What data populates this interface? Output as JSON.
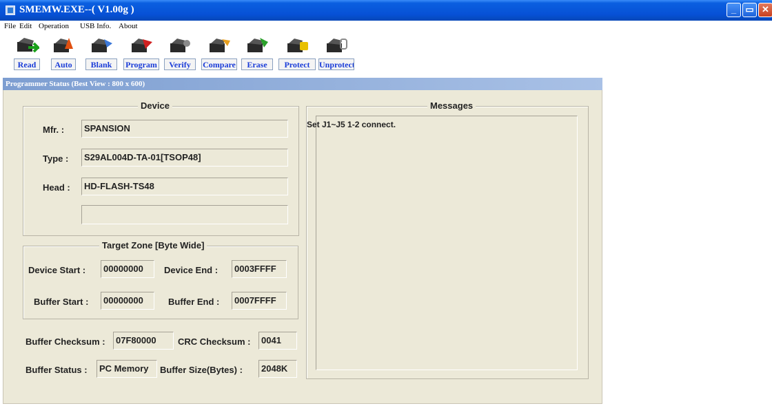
{
  "window": {
    "title": "SMEMW.EXE--( V1.00g )",
    "controls": [
      "minimize-icon",
      "maximize-icon",
      "close-icon"
    ]
  },
  "menu": [
    "File",
    "Edit",
    "Operation",
    "USB Info.",
    "About"
  ],
  "toolbar": [
    {
      "label": "Read",
      "icon": "read-icon"
    },
    {
      "label": "Auto",
      "icon": "auto-icon"
    },
    {
      "label": "Blank",
      "icon": "blank-icon"
    },
    {
      "label": "Program",
      "icon": "program-icon"
    },
    {
      "label": "Verify",
      "icon": "verify-icon"
    },
    {
      "label": "Compare",
      "icon": "compare-icon"
    },
    {
      "label": "Erase",
      "icon": "erase-icon"
    },
    {
      "label": "Protect",
      "icon": "protect-icon"
    },
    {
      "label": "Unprotect",
      "icon": "unprotect-icon"
    }
  ],
  "status_window": {
    "title": "Programmer Status  (Best View : 800 x 600)",
    "device": {
      "legend": "Device",
      "mfr_label": "Mfr. :",
      "mfr_value": "SPANSION",
      "type_label": "Type :",
      "type_value": "S29AL004D-TA-01[TSOP48]",
      "head_label": "Head :",
      "head_value": "HD-FLASH-TS48",
      "extra_value": ""
    },
    "target_zone": {
      "legend": "Target Zone [Byte Wide]",
      "device_start_label": "Device Start :",
      "device_start_value": "00000000",
      "device_end_label": "Device End :",
      "device_end_value": "0003FFFF",
      "buffer_start_label": "Buffer Start :",
      "buffer_start_value": "00000000",
      "buffer_end_label": "Buffer End :",
      "buffer_end_value": "0007FFFF"
    },
    "buffer_checksum_label": "Buffer Checksum :",
    "buffer_checksum_value": "07F80000",
    "crc_checksum_label": "CRC Checksum :",
    "crc_checksum_value": "0041",
    "buffer_status_label": "Buffer Status :",
    "buffer_status_value": "PC Memory",
    "buffer_size_label": "Buffer Size(Bytes) :",
    "buffer_size_value": "2048K",
    "messages": {
      "legend": "Messages",
      "text": "Set J1~J5 1-2 connect."
    }
  },
  "colors": {
    "titlebar": "#0751d6",
    "panel": "#ece9d8",
    "toolbar_label": "#1a3cd8"
  }
}
